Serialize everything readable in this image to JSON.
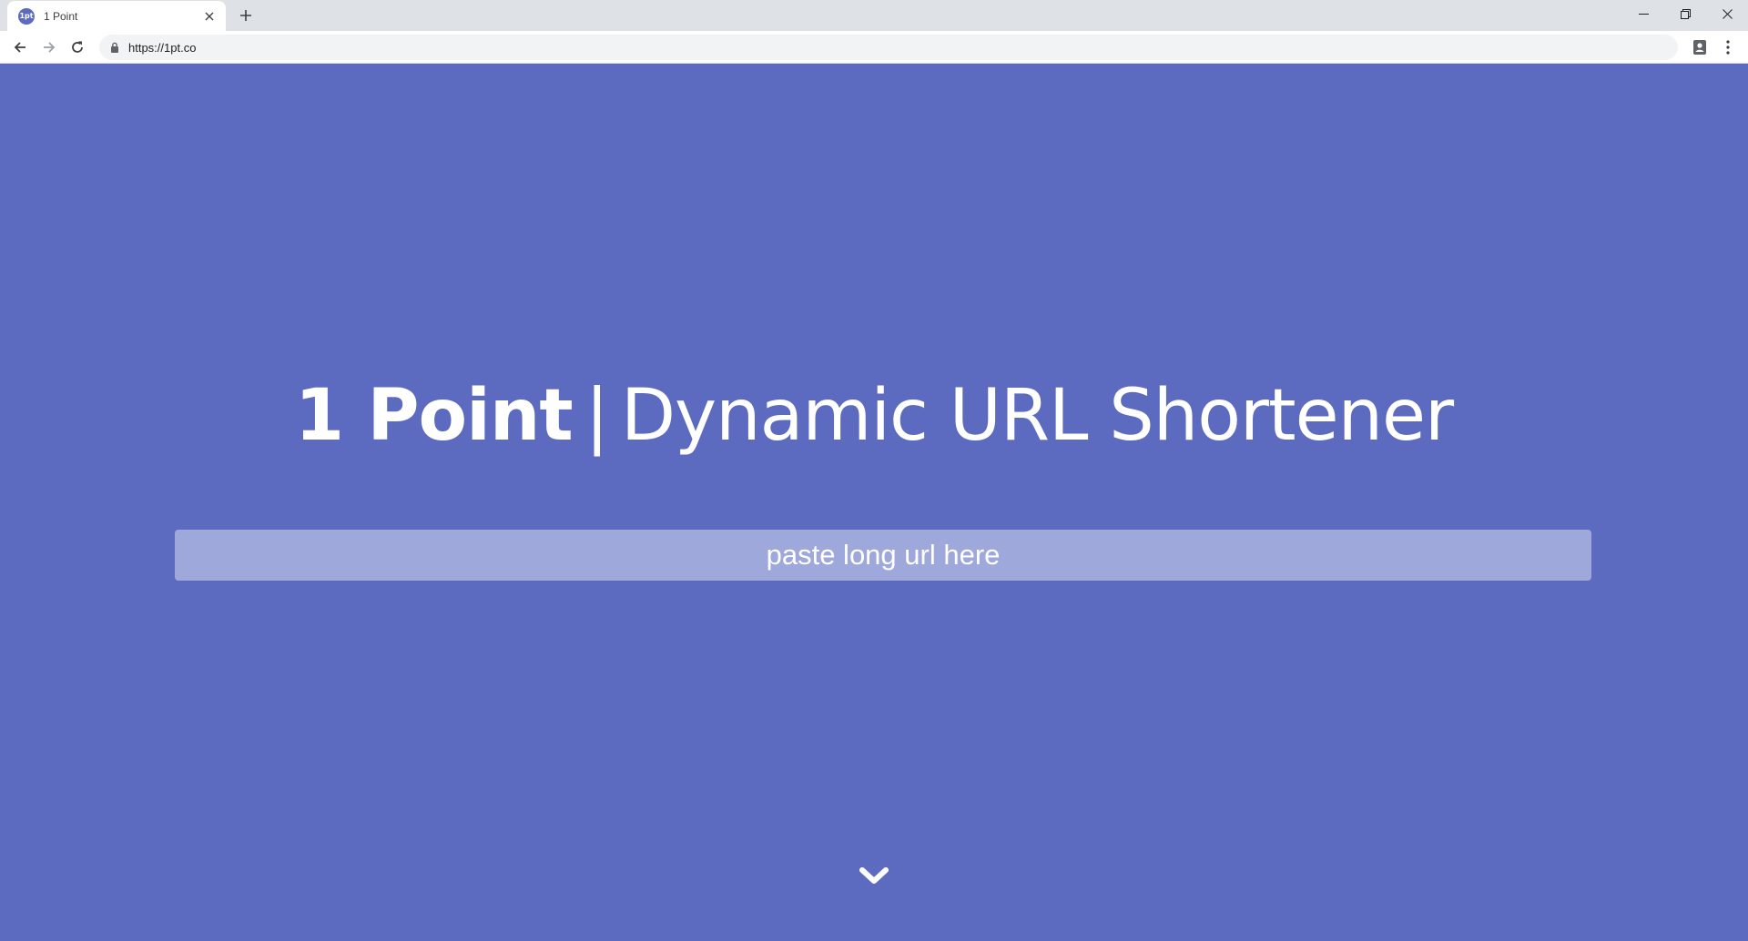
{
  "browser": {
    "tab": {
      "favicon_text": "1pt",
      "title": "1 Point"
    },
    "address_bar": {
      "url": "https://1pt.co"
    }
  },
  "page": {
    "hero": {
      "brand": "1 Point",
      "separator": "|",
      "tagline": "Dynamic URL Shortener"
    },
    "url_input": {
      "placeholder": "paste long url here",
      "value": ""
    }
  },
  "colors": {
    "page_background": "#5c6bc0",
    "input_background": "#9fa8da",
    "text": "#ffffff"
  },
  "icons": {
    "scroll": "chevron-down-icon"
  }
}
